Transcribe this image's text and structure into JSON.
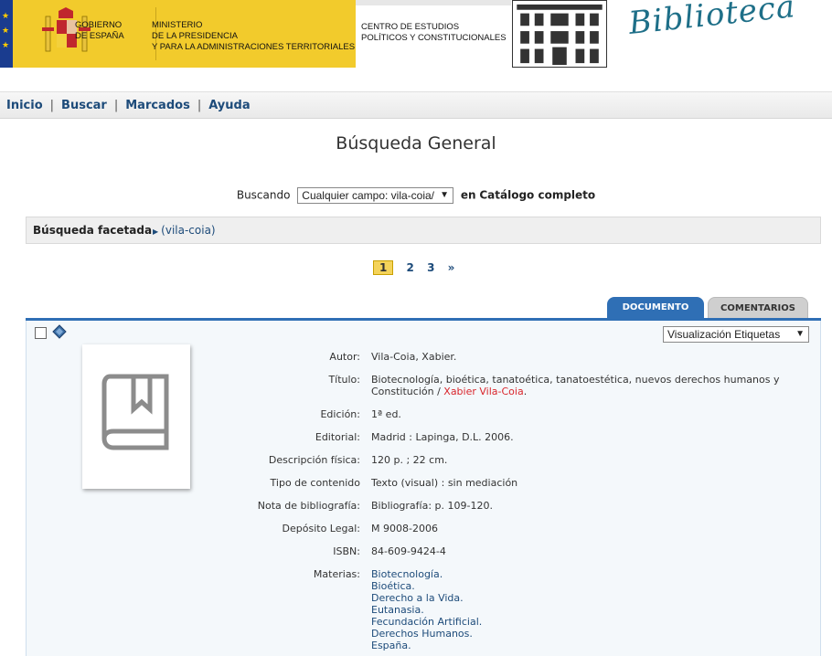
{
  "header": {
    "gov_line1": "GOBIERNO",
    "gov_line2": "DE ESPAÑA",
    "ministry_line1": "MINISTERIO",
    "ministry_line2": "DE LA PRESIDENCIA",
    "ministry_line3": "Y PARA LA ADMINISTRACIONES TERRITORIALES",
    "center_line1": "CENTRO DE ESTUDIOS",
    "center_line2": "POLÍTICOS Y CONSTITUCIONALES",
    "brand": "Biblioteca"
  },
  "nav": {
    "inicio": "Inicio",
    "buscar": "Buscar",
    "marcados": "Marcados",
    "ayuda": "Ayuda",
    "sep": "|"
  },
  "page": {
    "title": "Búsqueda General"
  },
  "search": {
    "prefix": "Buscando",
    "field_value": "Cualquier campo: vila-coia/",
    "suffix_in": "en",
    "catalog": "Catálogo completo"
  },
  "facets": {
    "label": "Búsqueda facetada",
    "term": "(vila-coia)"
  },
  "pager": {
    "current": "1",
    "pages": [
      "2",
      "3"
    ],
    "next": "»"
  },
  "tabs": {
    "documento": "DOCUMENTO",
    "comentarios": "COMENTARIOS"
  },
  "record": {
    "view_mode": "Visualización Etiquetas",
    "autor_label": "Autor:",
    "autor_value": "Vila-Coia, Xabier.",
    "titulo_label": "Título:",
    "titulo_value": "Biotecnología, bioética, tanatoética, tanatoestética, nuevos derechos humanos y Constitución /",
    "titulo_author": "Xabier Vila-Coia",
    "titulo_end": ".",
    "edicion_label": "Edición:",
    "edicion_value": "1ª ed.",
    "editorial_label": "Editorial:",
    "editorial_value": "Madrid : Lapinga, D.L. 2006.",
    "descripcion_label": "Descripción física:",
    "descripcion_value": "120 p. ; 22 cm.",
    "tipo_label": "Tipo de contenido",
    "tipo_value": "Texto (visual) : sin mediación",
    "nota_label": "Nota de bibliografía:",
    "nota_value": "Bibliografía: p. 109-120.",
    "deposito_label": "Depósito Legal:",
    "deposito_value": "M 9008-2006",
    "isbn_label": "ISBN:",
    "isbn_value": "84-609-9424-4",
    "materias_label": "Materias:",
    "materias": [
      "Biotecnología.",
      "Bioética.",
      "Derecho a la Vida.",
      "Eutanasia.",
      "Fecundación Artificial.",
      "Derechos Humanos.",
      "España."
    ]
  },
  "colors": {
    "nav_blue": "#1d4b7a",
    "tab_blue": "#2f6fb5",
    "gov_yellow": "#f2cb2c",
    "author_red": "#d9252b"
  }
}
